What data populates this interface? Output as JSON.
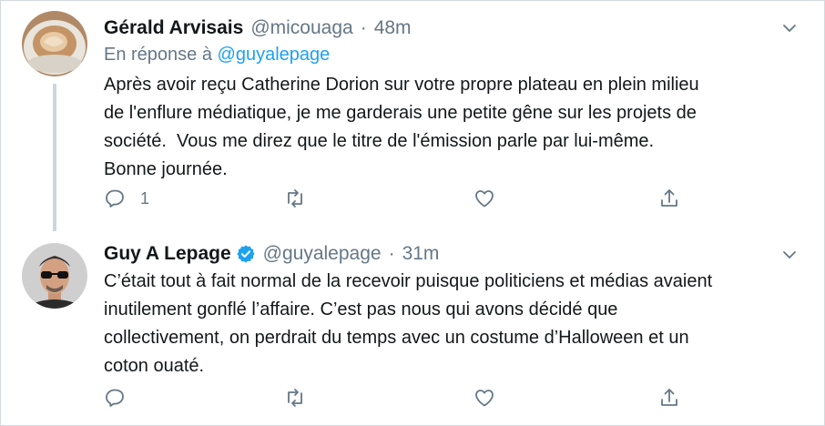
{
  "tweets": [
    {
      "author_name": "Gérald Arvisais",
      "handle": "@micouaga",
      "separator": "·",
      "time": "48m",
      "reply_prefix": "En réponse à",
      "reply_handle": "@guyalepage",
      "lines": [
        "Après avoir reçu Catherine Dorion sur votre propre plateau en plein milieu",
        "de l'enflure médiatique, je me garderais une petite gêne sur les projets de",
        "société.  Vous me direz que le titre de l'émission parle par lui-même.",
        "Bonne journée."
      ],
      "reply_count": "1",
      "avatar_icon": "coffee-cup-photo",
      "verified": false
    },
    {
      "author_name": "Guy A Lepage",
      "handle": "@guyalepage",
      "separator": "·",
      "time": "31m",
      "lines": [
        "C’était tout à fait normal de la recevoir puisque politiciens et médias avaient",
        "inutilement gonflé l’affaire. C’est pas nous qui avons décidé que",
        "collectivement, on perdrait du temps avec un costume d’Halloween et un",
        "coton ouaté."
      ],
      "reply_count": "",
      "avatar_icon": "man-with-sunglasses-photo",
      "verified": true
    }
  ],
  "colors": {
    "text": "#14171a",
    "secondary": "#657786",
    "link": "#1da1f2",
    "verified": "#1da1f2",
    "thread_line": "#ccd6dd",
    "border": "#d4d9dd"
  },
  "icons": [
    "reply-icon",
    "retweet-icon",
    "like-icon",
    "share-icon",
    "chevron-down-icon",
    "verified-badge-icon"
  ]
}
